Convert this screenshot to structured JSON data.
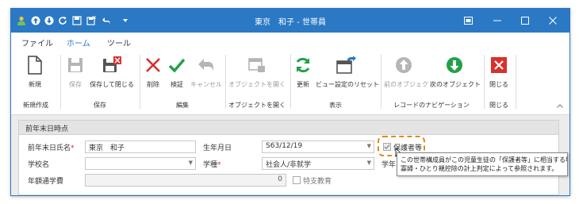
{
  "window": {
    "title": "東京　和子 - 世帯員"
  },
  "colors": {
    "accent": "#2b78c5",
    "highlight": "#e08a1e",
    "danger": "#d9302c",
    "success": "#23a047"
  },
  "quick_access_icons": [
    "user-icon",
    "up-arrow-circle-icon",
    "down-arrow-circle-icon",
    "refresh-icon",
    "save-icon",
    "save-close-icon",
    "undo-icon",
    "dropdown-caret-icon"
  ],
  "menu": {
    "tabs": [
      "ファイル",
      "ホーム",
      "ツール"
    ],
    "active": "ホーム"
  },
  "ribbon": {
    "new_label": "新規",
    "save_label": "保存",
    "save_close_label": "保存して閉じる",
    "delete_label": "削除",
    "verify_label": "検証",
    "cancel_label": "キャンセル",
    "open_object_label": "オブジェクトを開く",
    "refresh_label": "更新",
    "reset_view_label": "ビュー設定のリセット",
    "prev_object_label": "前のオブジェクト",
    "next_object_label": "次のオブジェクト",
    "close_label": "閉じる",
    "groups": {
      "new_create": "新規作成",
      "save": "保存",
      "edit": "編集",
      "open_object": "オブジェクトを開く",
      "view": "表示",
      "record_nav": "レコードのナビゲーション",
      "close": "閉じる"
    }
  },
  "panel": {
    "title": "前年末日時点"
  },
  "form": {
    "name_label": "前年末日氏名",
    "name_value": "東京　和子",
    "birth_label": "生年月日",
    "birth_value": "S63/12/19",
    "guardian_label": "保護者等",
    "school_label": "学校名",
    "school_value": "",
    "grade_label": "学種",
    "grade_value": "社会人/非就学",
    "tuition_label": "年額通学費",
    "tuition_value": "0",
    "special_label": "特支教育",
    "school_year_label_partial": "学年"
  },
  "tooltip": {
    "line1": "この世帯構成員がこの児童生徒の「保護者等」に相当する場",
    "line2": "寡婦・ひとり親控除の計上判定によって参照されます。"
  }
}
